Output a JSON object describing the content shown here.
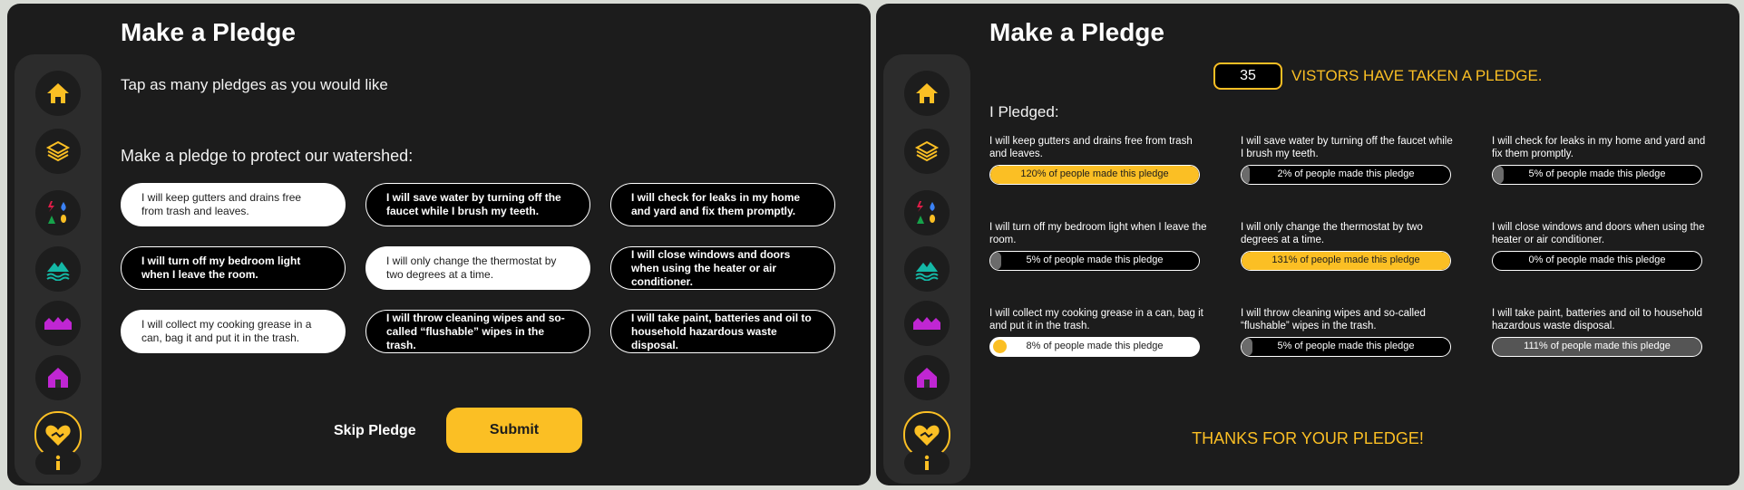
{
  "colors": {
    "accent": "#fbbf24",
    "panel": "#1c1c1c",
    "sidebar": "#2c2c2c",
    "magenta": "#c026d3",
    "teal": "#14b8a6"
  },
  "sidebar_icons": [
    "home-icon",
    "layers-icon",
    "hazards-icon",
    "watershed-icon",
    "neighborhood-icon",
    "house-icon",
    "pledge-heart-icon",
    "info-icon"
  ],
  "pledge_screen": {
    "title": "Make a Pledge",
    "subtitle": "Tap as many pledges as you would like",
    "prompt": "Make a pledge to protect our watershed:",
    "pledges": [
      {
        "text": "I will keep gutters and drains free from trash and leaves.",
        "selected": true
      },
      {
        "text": "I will save water by turning off the faucet while I brush my teeth.",
        "selected": false
      },
      {
        "text": "I will check for leaks in my home and yard and fix them promptly.",
        "selected": false
      },
      {
        "text": "I will turn off my bedroom light when I leave the room.",
        "selected": false
      },
      {
        "text": "I will only change the thermostat by two degrees at a time.",
        "selected": true
      },
      {
        "text": "I will close windows and doors when using the heater or air conditioner.",
        "selected": false
      },
      {
        "text": "I will collect my cooking grease in a can, bag it and put it in the trash.",
        "selected": true
      },
      {
        "text": "I will throw cleaning wipes and so-called “flushable” wipes in the trash.",
        "selected": false
      },
      {
        "text": "I will take paint, batteries and oil to household hazardous waste disposal.",
        "selected": false
      }
    ],
    "skip_label": "Skip Pledge",
    "submit_label": "Submit"
  },
  "results_screen": {
    "title": "Make a Pledge",
    "visitor_count": "35",
    "visitor_text": "VISTORS HAVE TAKEN A PLEDGE.",
    "pledged_label": "I Pledged:",
    "results": [
      {
        "text": "I will keep gutters and drains free from trash and leaves.",
        "bar_label": "120% of people made this pledge",
        "fill": 1.0,
        "style": "highlight"
      },
      {
        "text": "I will save water by turning off the faucet while I brush my teeth.",
        "bar_label": "2% of people made this pledge",
        "fill": 0.02,
        "style": "plain"
      },
      {
        "text": "I will check for leaks in my home and yard and fix them promptly.",
        "bar_label": "5% of people made this pledge",
        "fill": 0.05,
        "style": "plain"
      },
      {
        "text": "I will turn off my bedroom light when I leave the room.",
        "bar_label": "5% of people made this pledge",
        "fill": 0.05,
        "style": "plain"
      },
      {
        "text": "I will only change the thermostat by two degrees at a time.",
        "bar_label": "131% of people made this pledge",
        "fill": 1.0,
        "style": "highlight"
      },
      {
        "text": "I will close windows and doors when using the heater or air conditioner.",
        "bar_label": "0% of people made this pledge",
        "fill": 0.0,
        "style": "plain"
      },
      {
        "text": "I will collect my cooking grease in a can, bag it and put it in the trash.",
        "bar_label": "8% of people made this pledge",
        "fill": 0.08,
        "style": "white"
      },
      {
        "text": "I will throw cleaning wipes and so-called “flushable” wipes in the trash.",
        "bar_label": "5% of people made this pledge",
        "fill": 0.05,
        "style": "plain"
      },
      {
        "text": "I will take paint, batteries and oil to household hazardous waste disposal.",
        "bar_label": "111% of people made this pledge",
        "fill": 1.0,
        "style": "grey"
      }
    ],
    "thanks": "THANKS FOR YOUR PLEDGE!"
  }
}
